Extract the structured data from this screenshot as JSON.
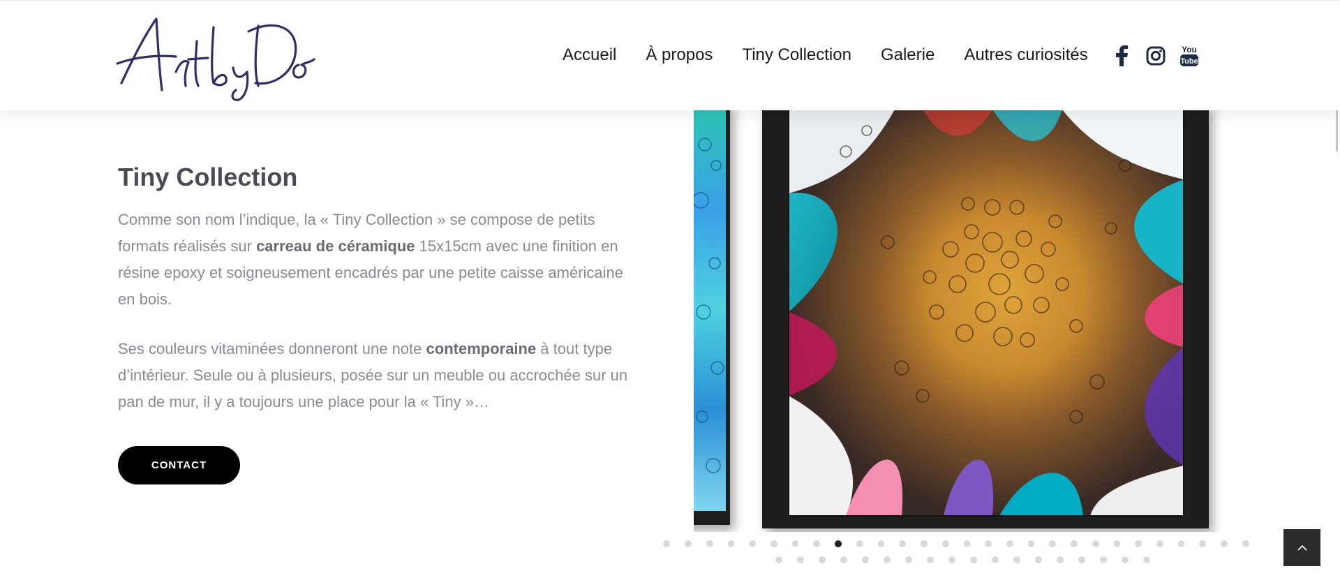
{
  "header": {
    "logo_text": "ArtbyDo",
    "nav": [
      "Accueil",
      "À propos",
      "Tiny Collection",
      "Galerie",
      "Autres curiosités"
    ],
    "social": [
      {
        "name": "facebook-icon"
      },
      {
        "name": "instagram-icon"
      },
      {
        "name": "youtube-icon",
        "line1": "You",
        "line2": "Tube"
      }
    ]
  },
  "main": {
    "title": "Tiny Collection",
    "p1": {
      "a": "Comme son nom l’indique, la « Tiny Collection » se compose de petits formats réalisés sur ",
      "b": "carreau de céramique",
      "c": " 15x15cm avec une finition en résine epoxy et soigneusement encadrés par une petite caisse américaine en bois."
    },
    "p2": {
      "a": "Ses couleurs vitaminées donneront une note ",
      "b": "contemporaine",
      "c": " à tout type d’intérieur. Seule ou à plusieurs, posée sur un meuble ou accrochée sur un pan de mur, il y a toujours une place pour la « Tiny »…"
    },
    "contact_label": "CONTACT"
  },
  "slider": {
    "row1_count": 28,
    "row2_count": 18,
    "active_index": 8
  },
  "colors": {
    "logo": "#2f2f66",
    "button": "#000000",
    "dot": "#d9d9d9",
    "dot_active": "#222222"
  }
}
